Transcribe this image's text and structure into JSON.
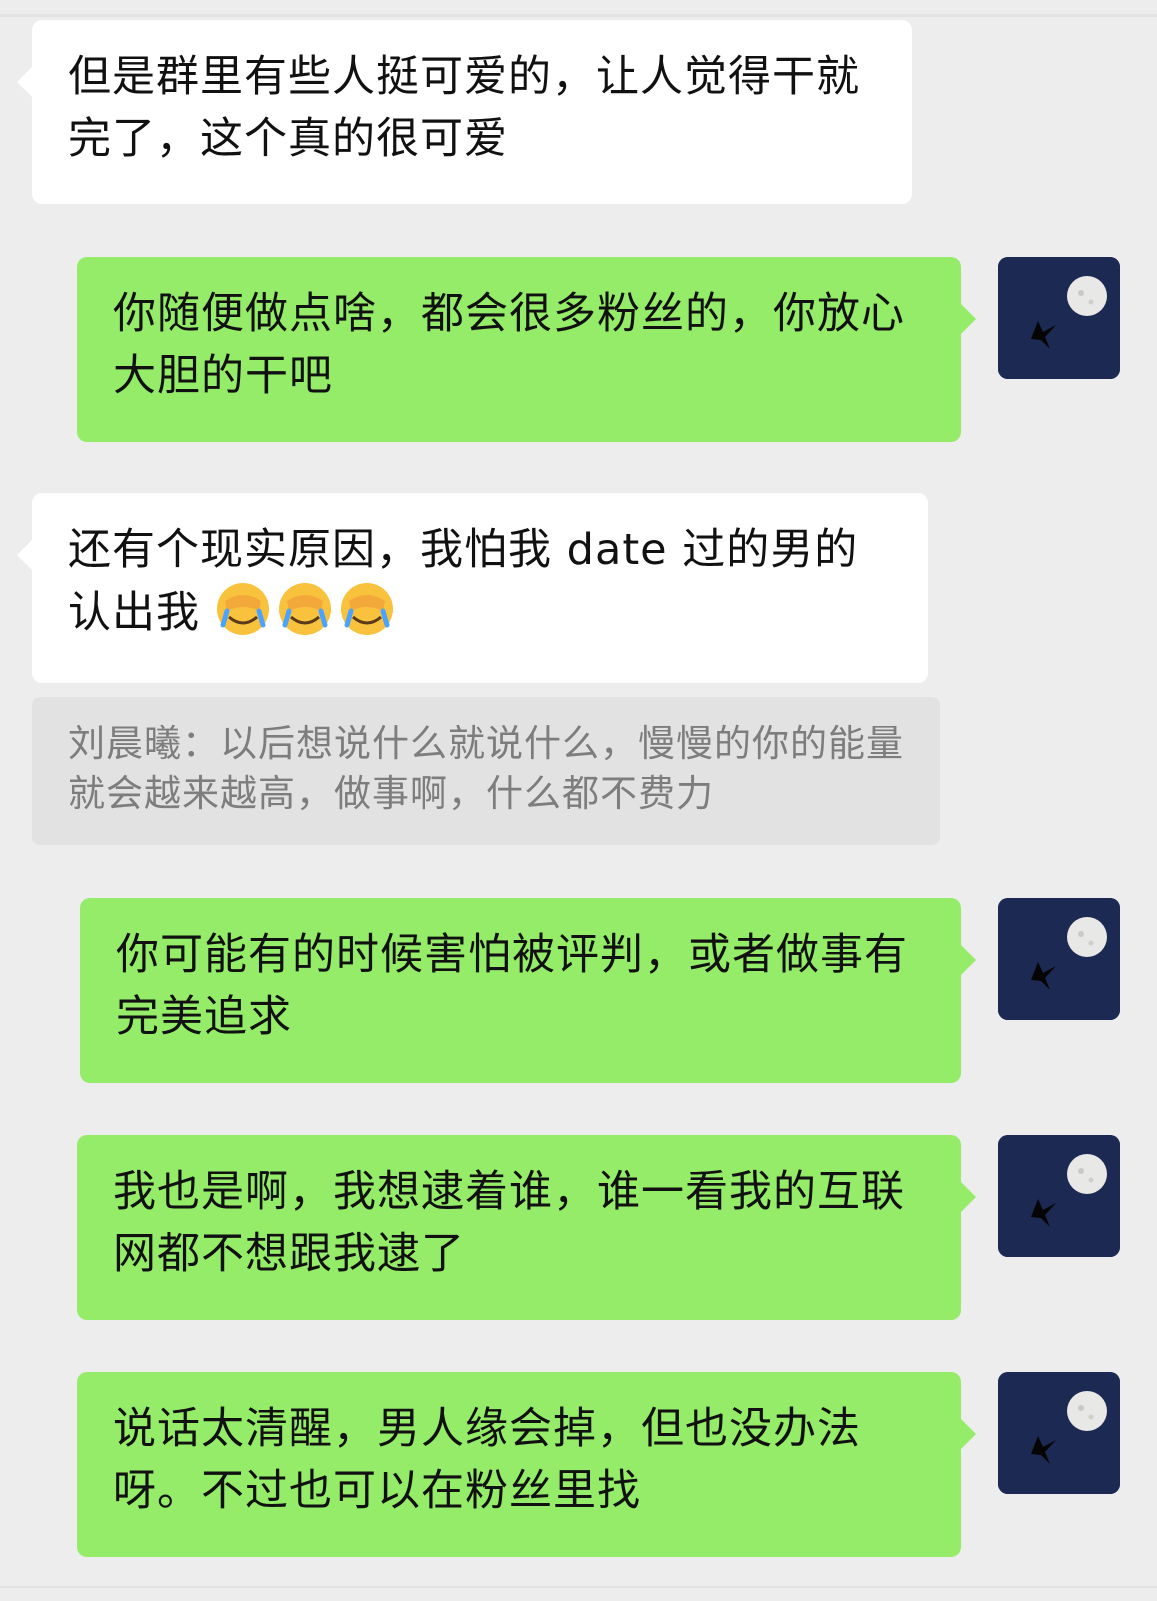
{
  "chat": {
    "messages": [
      {
        "direction": "incoming",
        "text": "但是群里有些人挺可爱的，让人觉得干就完了，这个真的很可爱"
      },
      {
        "direction": "outgoing",
        "text": "你随便做点啥，都会很多粉丝的，你放心大胆的干吧"
      },
      {
        "direction": "incoming",
        "text": "还有个现实原因，我怕我 date 过的男的认出我",
        "emoji": [
          "facepalm-crying-emoji",
          "facepalm-crying-emoji",
          "facepalm-crying-emoji"
        ]
      },
      {
        "direction": "quote",
        "text": "刘晨曦：以后想说什么就说什么，慢慢的你的能量就会越来越高，做事啊，什么都不费力"
      },
      {
        "direction": "outgoing",
        "text": "你可能有的时候害怕被评判，或者做事有完美追求"
      },
      {
        "direction": "outgoing",
        "text": "我也是啊，我想逮着谁，谁一看我的互联网都不想跟我逮了"
      },
      {
        "direction": "outgoing",
        "text": "说话太清醒，男人缘会掉，但也没办法呀。不过也可以在粉丝里找"
      }
    ]
  },
  "colors": {
    "background": "#ededed",
    "incoming_bubble": "#ffffff",
    "outgoing_bubble": "#95ec69",
    "quote_bubble": "#e2e2e2",
    "avatar_bg": "#1c2952"
  },
  "icons": {
    "avatar": "moon-bird-avatar",
    "emoji": "facepalm-crying-emoji"
  }
}
